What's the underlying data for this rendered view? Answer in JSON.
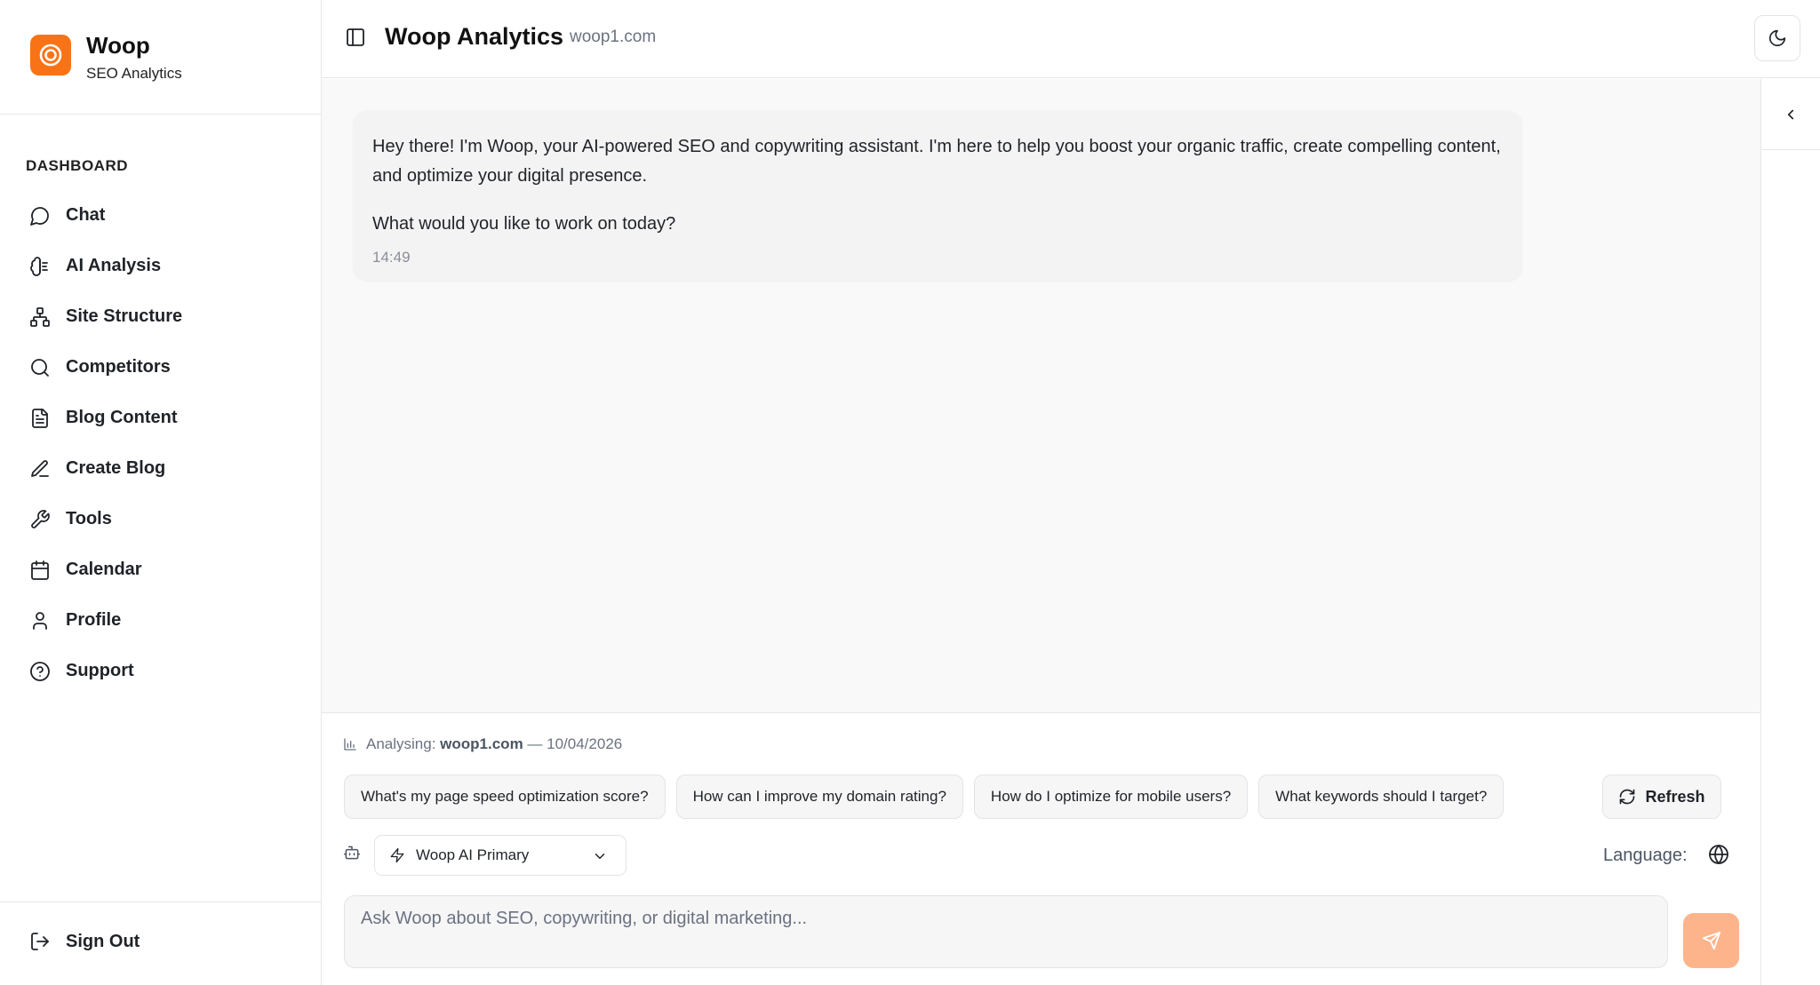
{
  "brand": {
    "name": "Woop",
    "subtitle": "SEO Analytics"
  },
  "sidebar": {
    "heading": "DASHBOARD",
    "items": [
      {
        "label": "Chat",
        "icon": "message-circle-icon"
      },
      {
        "label": "AI Analysis",
        "icon": "brain-icon"
      },
      {
        "label": "Site Structure",
        "icon": "network-icon"
      },
      {
        "label": "Competitors",
        "icon": "search-icon"
      },
      {
        "label": "Blog Content",
        "icon": "file-text-icon"
      },
      {
        "label": "Create Blog",
        "icon": "pen-icon"
      },
      {
        "label": "Tools",
        "icon": "wrench-icon"
      },
      {
        "label": "Calendar",
        "icon": "calendar-icon"
      },
      {
        "label": "Profile",
        "icon": "user-icon"
      },
      {
        "label": "Support",
        "icon": "help-circle-icon"
      }
    ],
    "signout": "Sign Out"
  },
  "header": {
    "title": "Woop Analytics",
    "domain": "woop1.com"
  },
  "chat": {
    "messages": [
      {
        "paragraph1": "Hey there! I'm Woop, your AI-powered SEO and copywriting assistant. I'm here to help you boost your organic traffic, create compelling content, and optimize your digital presence.",
        "paragraph2": "What would you like to work on today?",
        "time": "14:49"
      }
    ]
  },
  "composer": {
    "analysing_prefix": "Analysing:",
    "analysing_domain": "woop1.com",
    "analysing_suffix": "— 10/04/2026",
    "suggestions": [
      "What's my page speed optimization score?",
      "How can I improve my domain rating?",
      "How do I optimize for mobile users?",
      "What keywords should I target?"
    ],
    "refresh_label": "Refresh",
    "model": "Woop AI Primary",
    "language_label": "Language:",
    "input_placeholder": "Ask Woop about SEO, copywriting, or digital marketing..."
  },
  "colors": {
    "accent": "#f97316",
    "send_button": "#fdb48a"
  }
}
